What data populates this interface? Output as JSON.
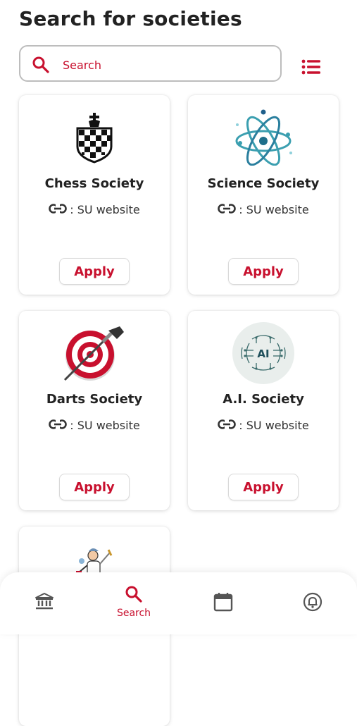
{
  "page": {
    "title": "Search for societies"
  },
  "search": {
    "placeholder": "Search"
  },
  "colors": {
    "accent": "#c8102e",
    "icon_gray": "#555555"
  },
  "societies": [
    {
      "name": "Chess Society",
      "link_text": ": SU website",
      "button": "Apply",
      "logo": "chess-king-icon"
    },
    {
      "name": "Science Society",
      "link_text": ": SU website",
      "button": "Apply",
      "logo": "atom-icon"
    },
    {
      "name": "Darts Society",
      "link_text": ": SU website",
      "button": "Apply",
      "logo": "dartboard-icon"
    },
    {
      "name": "A.I. Society",
      "link_text": ": SU website",
      "button": "Apply",
      "logo": "ai-brain-icon",
      "logo_text": "AI"
    },
    {
      "logo": "fencing-figure-icon"
    }
  ],
  "nav": {
    "items": [
      {
        "icon": "institution-icon",
        "label": ""
      },
      {
        "icon": "search-icon",
        "label": "Search",
        "active": true
      },
      {
        "icon": "calendar-icon",
        "label": ""
      },
      {
        "icon": "notification-icon",
        "label": ""
      }
    ]
  }
}
